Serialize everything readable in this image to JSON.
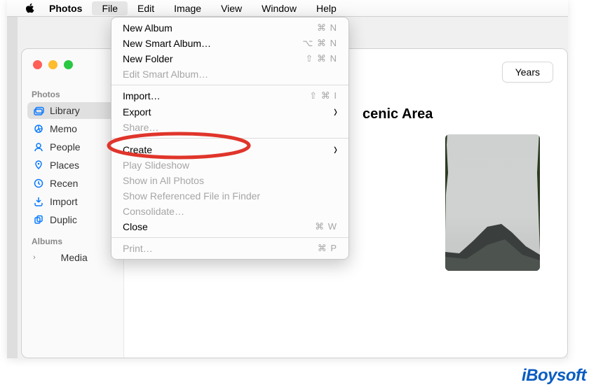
{
  "menubar": {
    "items": [
      "Photos",
      "File",
      "Edit",
      "Image",
      "View",
      "Window",
      "Help"
    ],
    "app_bold": "Photos",
    "open": "File"
  },
  "window": {
    "toolbar": {
      "years_button": "Years"
    },
    "main": {
      "heading": "cenic Area"
    }
  },
  "sidebar": {
    "section1_label": "Photos",
    "items1": [
      {
        "label": "Library",
        "icon": "photo-stack-icon",
        "selected": true
      },
      {
        "label": "Memo",
        "icon": "memories-icon"
      },
      {
        "label": "People",
        "icon": "people-icon"
      },
      {
        "label": "Places",
        "icon": "pin-icon"
      },
      {
        "label": "Recen",
        "icon": "clock-icon"
      },
      {
        "label": "Import",
        "icon": "import-icon"
      },
      {
        "label": "Duplic",
        "icon": "duplicate-icon"
      }
    ],
    "section2_label": "Albums",
    "items2": [
      {
        "label": "Media",
        "icon": "disclosure-icon"
      }
    ]
  },
  "file_menu": {
    "items": [
      {
        "label": "New Album",
        "shortcut": "⌘ N"
      },
      {
        "label": "New Smart Album…",
        "shortcut": "⌥ ⌘ N"
      },
      {
        "label": "New Folder",
        "shortcut": "⇧ ⌘ N"
      },
      {
        "label": "Edit Smart Album…",
        "disabled": true
      },
      {
        "sep": true
      },
      {
        "label": "Import…",
        "shortcut": "⇧ ⌘ I",
        "highlight": true
      },
      {
        "label": "Export",
        "submenu": true
      },
      {
        "label": "Share…",
        "disabled": true
      },
      {
        "sep": true
      },
      {
        "label": "Create",
        "submenu": true
      },
      {
        "label": "Play Slideshow",
        "disabled": true
      },
      {
        "label": "Show in All Photos",
        "disabled": true
      },
      {
        "label": "Show Referenced File in Finder",
        "disabled": true
      },
      {
        "label": "Consolidate…",
        "disabled": true
      },
      {
        "label": "Close",
        "shortcut": "⌘ W"
      },
      {
        "sep": true
      },
      {
        "label": "Print…",
        "shortcut": "⌘ P",
        "disabled": true
      }
    ]
  },
  "watermark": "iBoysoft"
}
